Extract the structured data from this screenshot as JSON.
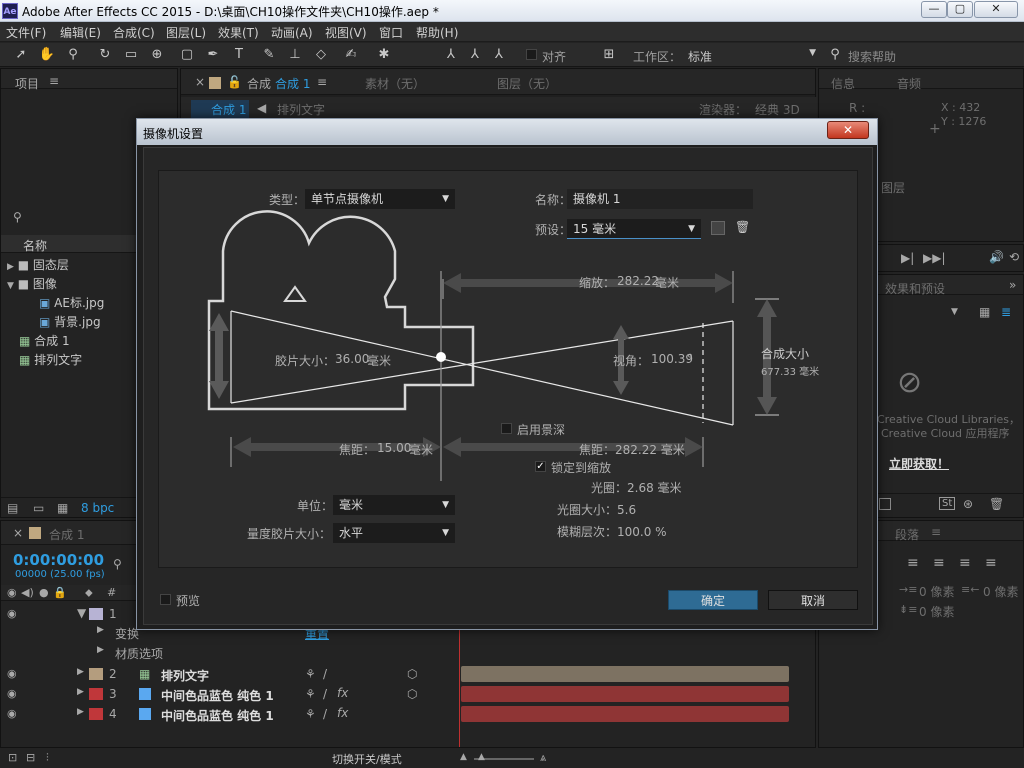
{
  "window": {
    "title": "Adobe After Effects CC 2015 - D:\\桌面\\CH10操作文件夹\\CH10操作.aep *",
    "logo": "Ae",
    "minimize": "—",
    "maximize": "▢",
    "close": "✕"
  },
  "menu": [
    "文件(F)",
    "编辑(E)",
    "合成(C)",
    "图层(L)",
    "效果(T)",
    "动画(A)",
    "视图(V)",
    "窗口",
    "帮助(H)"
  ],
  "toolbar": {
    "align": "对齐",
    "workspace_label": "工作区：",
    "workspace_value": "标准",
    "search_placeholder": "搜索帮助"
  },
  "project_panel": {
    "title": "项目",
    "col_name": "名称",
    "bpc": "8 bpc",
    "items": [
      {
        "label": "固态层"
      },
      {
        "label": "图像"
      },
      {
        "label": "AE标.jpg"
      },
      {
        "label": "背景.jpg"
      },
      {
        "label": "合成 1"
      },
      {
        "label": "排列文字"
      }
    ]
  },
  "comp_panel": {
    "tab_comp": "合成",
    "tab_comp_name": "合成 1",
    "tab_footage": "素材（无）",
    "tab_layer": "图层（无）",
    "sub_comp": "合成 1",
    "sub_layer": "排列文字",
    "renderer_label": "渲染器：",
    "renderer": "经典 3D"
  },
  "info_panel": {
    "tab_info": "信息",
    "tab_audio": "音频",
    "r": "R :",
    "x": "X : 432",
    "y": "Y : 1276",
    "layer": "图层"
  },
  "effects_panel": {
    "title": "效果和预设",
    "cc_line1": "Creative Cloud Libraries，",
    "cc_line2": "Creative Cloud 应用程序",
    "cc_link": "立即获取！"
  },
  "paragraph_panel": {
    "title": "段落",
    "indent1": "0 像素",
    "indent2": "0 像素",
    "indent3": "0 像素"
  },
  "timeline": {
    "tab": "合成 1",
    "timecode": "0:00:00:00",
    "frames": "00000 (25.00 fps)",
    "footer": "切换开关/模式",
    "col_hash": "#",
    "layers": [
      {
        "num": "1",
        "name": "",
        "color": "#b7b3d4"
      },
      {
        "num": "2",
        "name": "排列文字",
        "color": "#b49d7e"
      },
      {
        "num": "3",
        "name": "中间色品蓝色 纯色 1",
        "color": "#c0373a"
      },
      {
        "num": "4",
        "name": "中间色品蓝色 纯色 1",
        "color": "#c0373a"
      }
    ],
    "sub_transform": "变换",
    "sub_reset": "重置",
    "sub_material": "材质选项"
  },
  "dialog": {
    "title": "摄像机设置",
    "close": "✕",
    "type_label": "类型：",
    "type_value": "单节点摄像机",
    "name_label": "名称：",
    "name_value": "摄像机 1",
    "preset_label": "预设：",
    "preset_value": "15 毫米",
    "zoom_label": "缩放：",
    "zoom_value": "282.22",
    "zoom_unit": "毫米",
    "film_label": "胶片大小：",
    "film_value": "36.00",
    "film_unit": "毫米",
    "angle_label": "视角：",
    "angle_value": "100.39",
    "angle_unit": "°",
    "comp_size_label": "合成大小",
    "comp_size_value": "677.33 毫米",
    "dof_label": "启用景深",
    "focal_label": "焦距：",
    "focal_value": "15.00",
    "focal_unit": "毫米",
    "focus_dist": "焦距：282.22 毫米",
    "lock_zoom": "锁定到缩放",
    "aperture": "光圈：2.68 毫米",
    "fstop": "光圈大小：5.6",
    "blur": "模糊层次：100.0 %",
    "units_label": "单位：",
    "units_value": "毫米",
    "measure_label": "量度胶片大小：",
    "measure_value": "水平",
    "preview": "预览",
    "ok": "确定",
    "cancel": "取消"
  }
}
